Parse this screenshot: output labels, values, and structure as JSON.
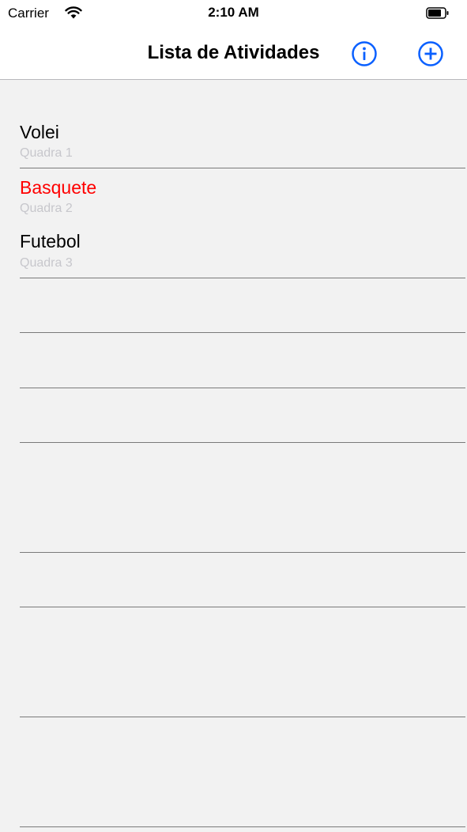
{
  "status_bar": {
    "carrier": "Carrier",
    "time": "2:10 AM",
    "wifi_icon": "wifi-icon",
    "battery_icon": "battery-icon"
  },
  "nav": {
    "title": "Lista de Atividades",
    "info_icon": "info-circle-icon",
    "add_icon": "plus-circle-icon",
    "tint_color": "#0a60ff"
  },
  "activities": [
    {
      "title": "Volei",
      "subtitle": "Quadra 1",
      "title_color": "#000000"
    },
    {
      "title": "Basquete",
      "subtitle": "Quadra 2",
      "title_color": "#ff0000"
    },
    {
      "title": "Futebol",
      "subtitle": "Quadra 3",
      "title_color": "#000000"
    }
  ]
}
